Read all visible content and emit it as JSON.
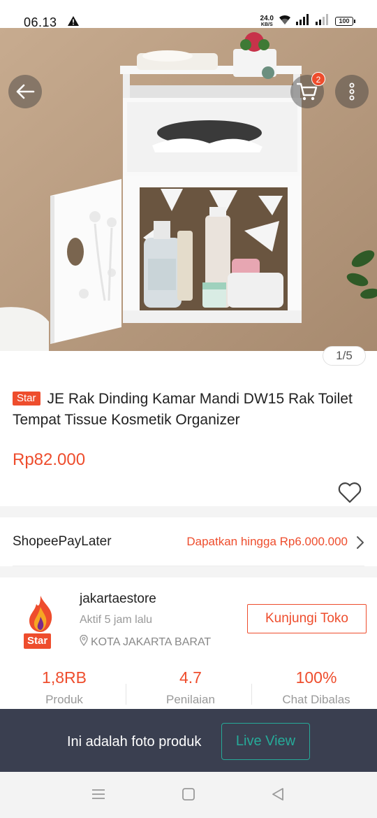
{
  "status_bar": {
    "time": "06.13",
    "net_speed": "24.0",
    "net_unit": "KB/S",
    "battery": "100"
  },
  "product_image": {
    "cart_count": "2",
    "counter": "1/5",
    "icons": [
      "back-arrow-icon",
      "cart-icon",
      "more-vertical-icon"
    ]
  },
  "product": {
    "badge": "Star",
    "title": "JE Rak Dinding Kamar Mandi DW15 Rak Toilet Tempat Tissue Kosmetik Organizer",
    "price": "Rp82.000"
  },
  "paylater": {
    "label": "ShopeePayLater",
    "offer": "Dapatkan hingga Rp6.000.000"
  },
  "shop": {
    "name": "jakartaestore",
    "active": "Aktif 5 jam lalu",
    "location": "KOTA JAKARTA BARAT",
    "badge": "Star",
    "visit_label": "Kunjungi Toko",
    "stats": [
      {
        "value": "1,8RB",
        "label": "Produk"
      },
      {
        "value": "4.7",
        "label": "Penilaian"
      },
      {
        "value": "100%",
        "label": "Chat Dibalas"
      }
    ]
  },
  "overlay": {
    "text": "Ini adalah foto produk",
    "button": "Live View"
  },
  "colors": {
    "accent": "#ee4d2d",
    "live": "#26aa99",
    "overlay_bg": "#3a3f50"
  }
}
